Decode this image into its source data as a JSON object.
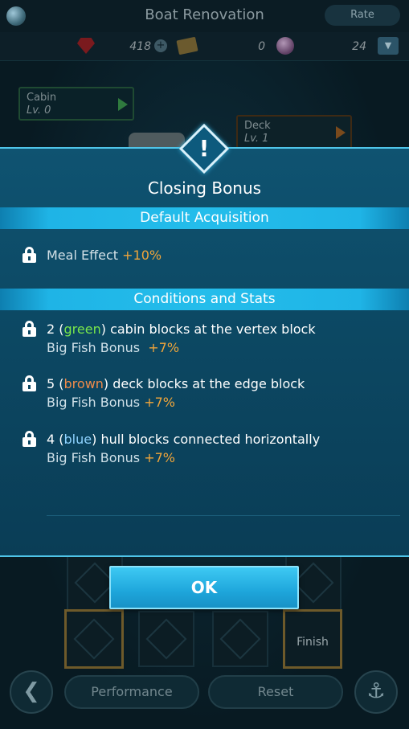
{
  "screen": {
    "title": "Boat Renovation",
    "rate_label": "Rate"
  },
  "resources": {
    "ruby": "418",
    "ticket": "0",
    "gem": "24"
  },
  "board": {
    "cabin": {
      "name": "Cabin",
      "level": "Lv. 0"
    },
    "deck": {
      "name": "Deck",
      "level": "Lv. 1"
    },
    "finish_label": "Finish"
  },
  "footer": {
    "performance_label": "Performance",
    "reset_label": "Reset"
  },
  "modal": {
    "title": "Closing Bonus",
    "default_section": "Default Acquisition",
    "default_item": {
      "label": "Meal Effect",
      "value": "+10%"
    },
    "conditions_section": "Conditions and Stats",
    "conditions": [
      {
        "count": "2 (",
        "color_word": "green",
        "rest": ") cabin blocks at the vertex block",
        "bonus_label": "Big Fish Bonus",
        "bonus_value": "+7%"
      },
      {
        "count": "5 (",
        "color_word": "brown",
        "rest": ") deck blocks at the edge block",
        "bonus_label": "Big Fish Bonus",
        "bonus_value": "+7%"
      },
      {
        "count": "4 (",
        "color_word": "blue",
        "rest": ") hull blocks connected horizontally",
        "bonus_label": "Big Fish Bonus",
        "bonus_value": "+7%"
      }
    ],
    "ok_label": "OK"
  },
  "colors": {
    "accent_orange": "#f0a53a",
    "green_word": "#79e64b",
    "brown_word": "#f08b4a",
    "blue_word": "#8fd3ff",
    "band": "#24bdeb"
  }
}
